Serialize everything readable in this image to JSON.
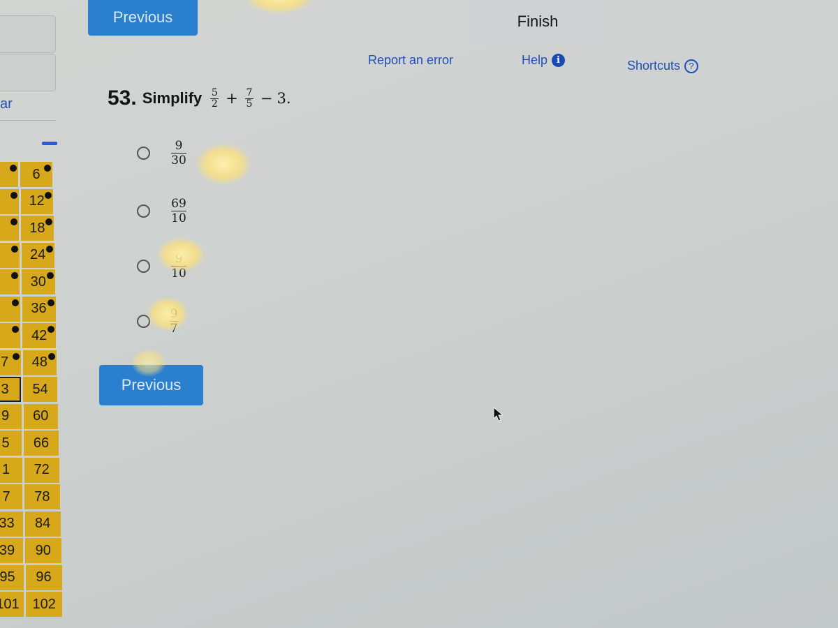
{
  "nav": {
    "previous_label": "Previous",
    "finish_label": "Finish",
    "report_error_label": "Report an error",
    "help_label": "Help",
    "help_icon": "info-circle-icon",
    "shortcuts_label": "Shortcuts",
    "shortcuts_icon": "question-circle-icon"
  },
  "left_panel": {
    "partial_label": "ar",
    "question_grid": [
      {
        "left": "",
        "right": "6",
        "left_done": true,
        "right_done": true
      },
      {
        "left": "",
        "right": "12",
        "left_done": true,
        "right_done": true
      },
      {
        "left": "",
        "right": "18",
        "left_done": true,
        "right_done": true
      },
      {
        "left": "",
        "right": "24",
        "left_done": true,
        "right_done": true
      },
      {
        "left": "",
        "right": "30",
        "left_done": true,
        "right_done": true
      },
      {
        "left": "",
        "right": "36",
        "left_done": true,
        "right_done": true
      },
      {
        "left": "",
        "right": "42",
        "left_done": true,
        "right_done": true
      },
      {
        "left": "7",
        "right": "48",
        "left_done": true,
        "right_done": true
      },
      {
        "left": "3",
        "right": "54",
        "left_done": false,
        "right_done": false,
        "current": "left"
      },
      {
        "left": "9",
        "right": "60",
        "left_done": false,
        "right_done": false
      },
      {
        "left": "5",
        "right": "66",
        "left_done": false,
        "right_done": false
      },
      {
        "left": "1",
        "right": "72",
        "left_done": false,
        "right_done": false
      },
      {
        "left": "7",
        "right": "78",
        "left_done": false,
        "right_done": false
      },
      {
        "left": "33",
        "right": "84",
        "left_done": false,
        "right_done": false
      },
      {
        "left": "39",
        "right": "90",
        "left_done": false,
        "right_done": false
      },
      {
        "left": "95",
        "right": "96",
        "left_done": false,
        "right_done": false
      },
      {
        "left": "101",
        "right": "102",
        "left_done": false,
        "right_done": false
      }
    ]
  },
  "question": {
    "number": "53.",
    "instruction": "Simplify",
    "expression": {
      "term1": {
        "num": "5",
        "den": "2"
      },
      "op1": "+",
      "term2": {
        "num": "7",
        "den": "5"
      },
      "op2": "−",
      "term3": "3."
    },
    "options": [
      {
        "num": "9",
        "den": "30",
        "selected": false
      },
      {
        "num": "69",
        "den": "10",
        "selected": false
      },
      {
        "num": "9",
        "den": "10",
        "selected": false
      },
      {
        "num": "9",
        "den": "7",
        "selected": false
      }
    ]
  },
  "colors": {
    "primary_button": "#2a7fcf",
    "link": "#1f4fb8",
    "grid_cell": "#d7a81a",
    "background": "#cdd1cf"
  }
}
